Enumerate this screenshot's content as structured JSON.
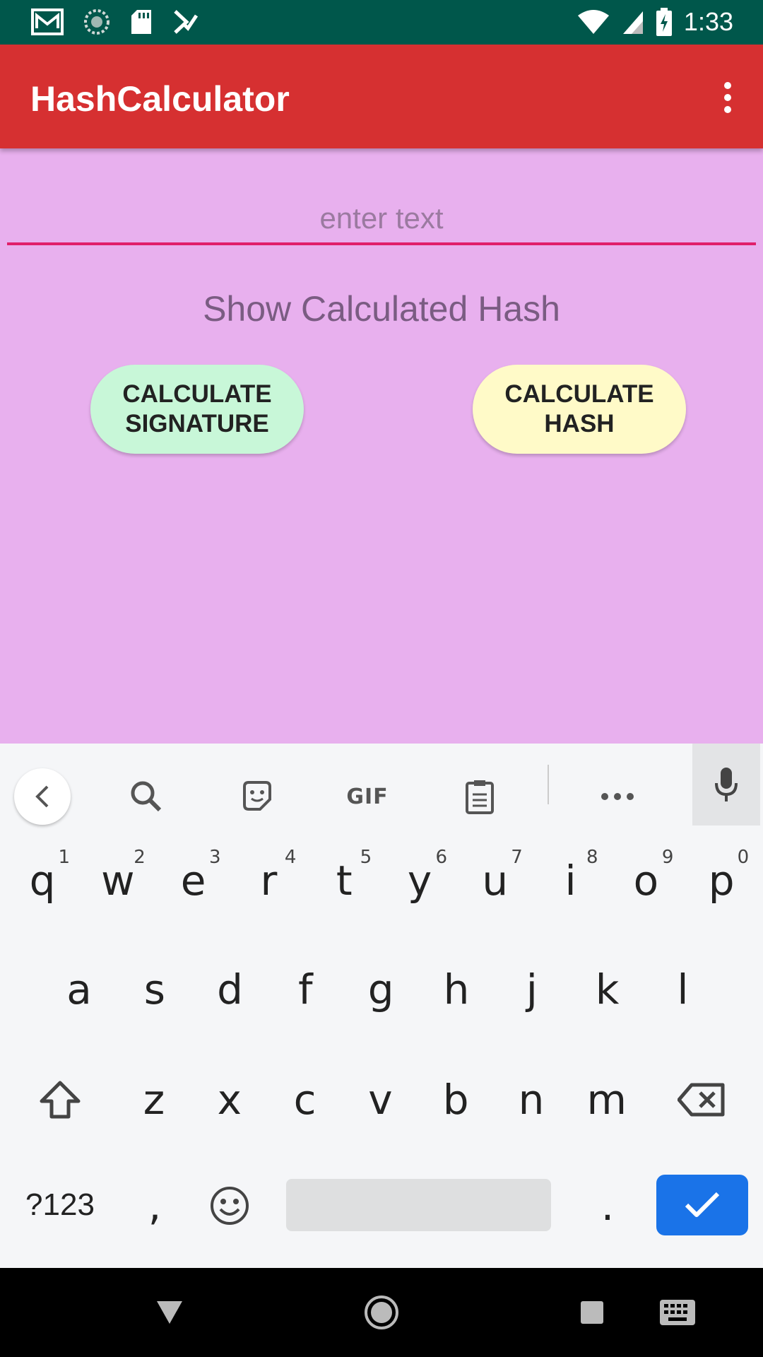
{
  "status_bar": {
    "time": "1:33",
    "icons": [
      "gmail-icon",
      "sync-icon",
      "sd-card-icon",
      "task-check-icon",
      "wifi-icon",
      "signal-icon",
      "battery-charging-icon"
    ]
  },
  "app_bar": {
    "title": "HashCalculator",
    "menu_icon": "more-vert-icon"
  },
  "main": {
    "input": {
      "placeholder": "enter text",
      "value": ""
    },
    "result_label": "Show Calculated Hash",
    "buttons": {
      "signature": "CALCULATE SIGNATURE",
      "hash": "CALCULATE HASH"
    }
  },
  "keyboard": {
    "toolbar": [
      "back-icon",
      "search-icon",
      "sticker-icon",
      "GIF",
      "clipboard-icon",
      "more-horiz-icon",
      "mic-icon"
    ],
    "gif_label": "GIF",
    "row1": [
      {
        "k": "q",
        "h": "1"
      },
      {
        "k": "w",
        "h": "2"
      },
      {
        "k": "e",
        "h": "3"
      },
      {
        "k": "r",
        "h": "4"
      },
      {
        "k": "t",
        "h": "5"
      },
      {
        "k": "y",
        "h": "6"
      },
      {
        "k": "u",
        "h": "7"
      },
      {
        "k": "i",
        "h": "8"
      },
      {
        "k": "o",
        "h": "9"
      },
      {
        "k": "p",
        "h": "0"
      }
    ],
    "row2": [
      "a",
      "s",
      "d",
      "f",
      "g",
      "h",
      "j",
      "k",
      "l"
    ],
    "row3": [
      "z",
      "x",
      "c",
      "v",
      "b",
      "n",
      "m"
    ],
    "sym_label": "?123",
    "comma": ",",
    "period": ".",
    "accent_color": "#1a73e8"
  },
  "nav_bar": {
    "icons": [
      "back-triangle-icon",
      "home-circle-icon",
      "recents-square-icon",
      "keyboard-switch-icon"
    ]
  },
  "colors": {
    "status_bar": "#00574b",
    "app_bar": "#d63031",
    "background": "#e8b0ee",
    "input_underline": "#e01f6a",
    "signature_button": "#c8f7d8",
    "hash_button": "#fffac8"
  }
}
